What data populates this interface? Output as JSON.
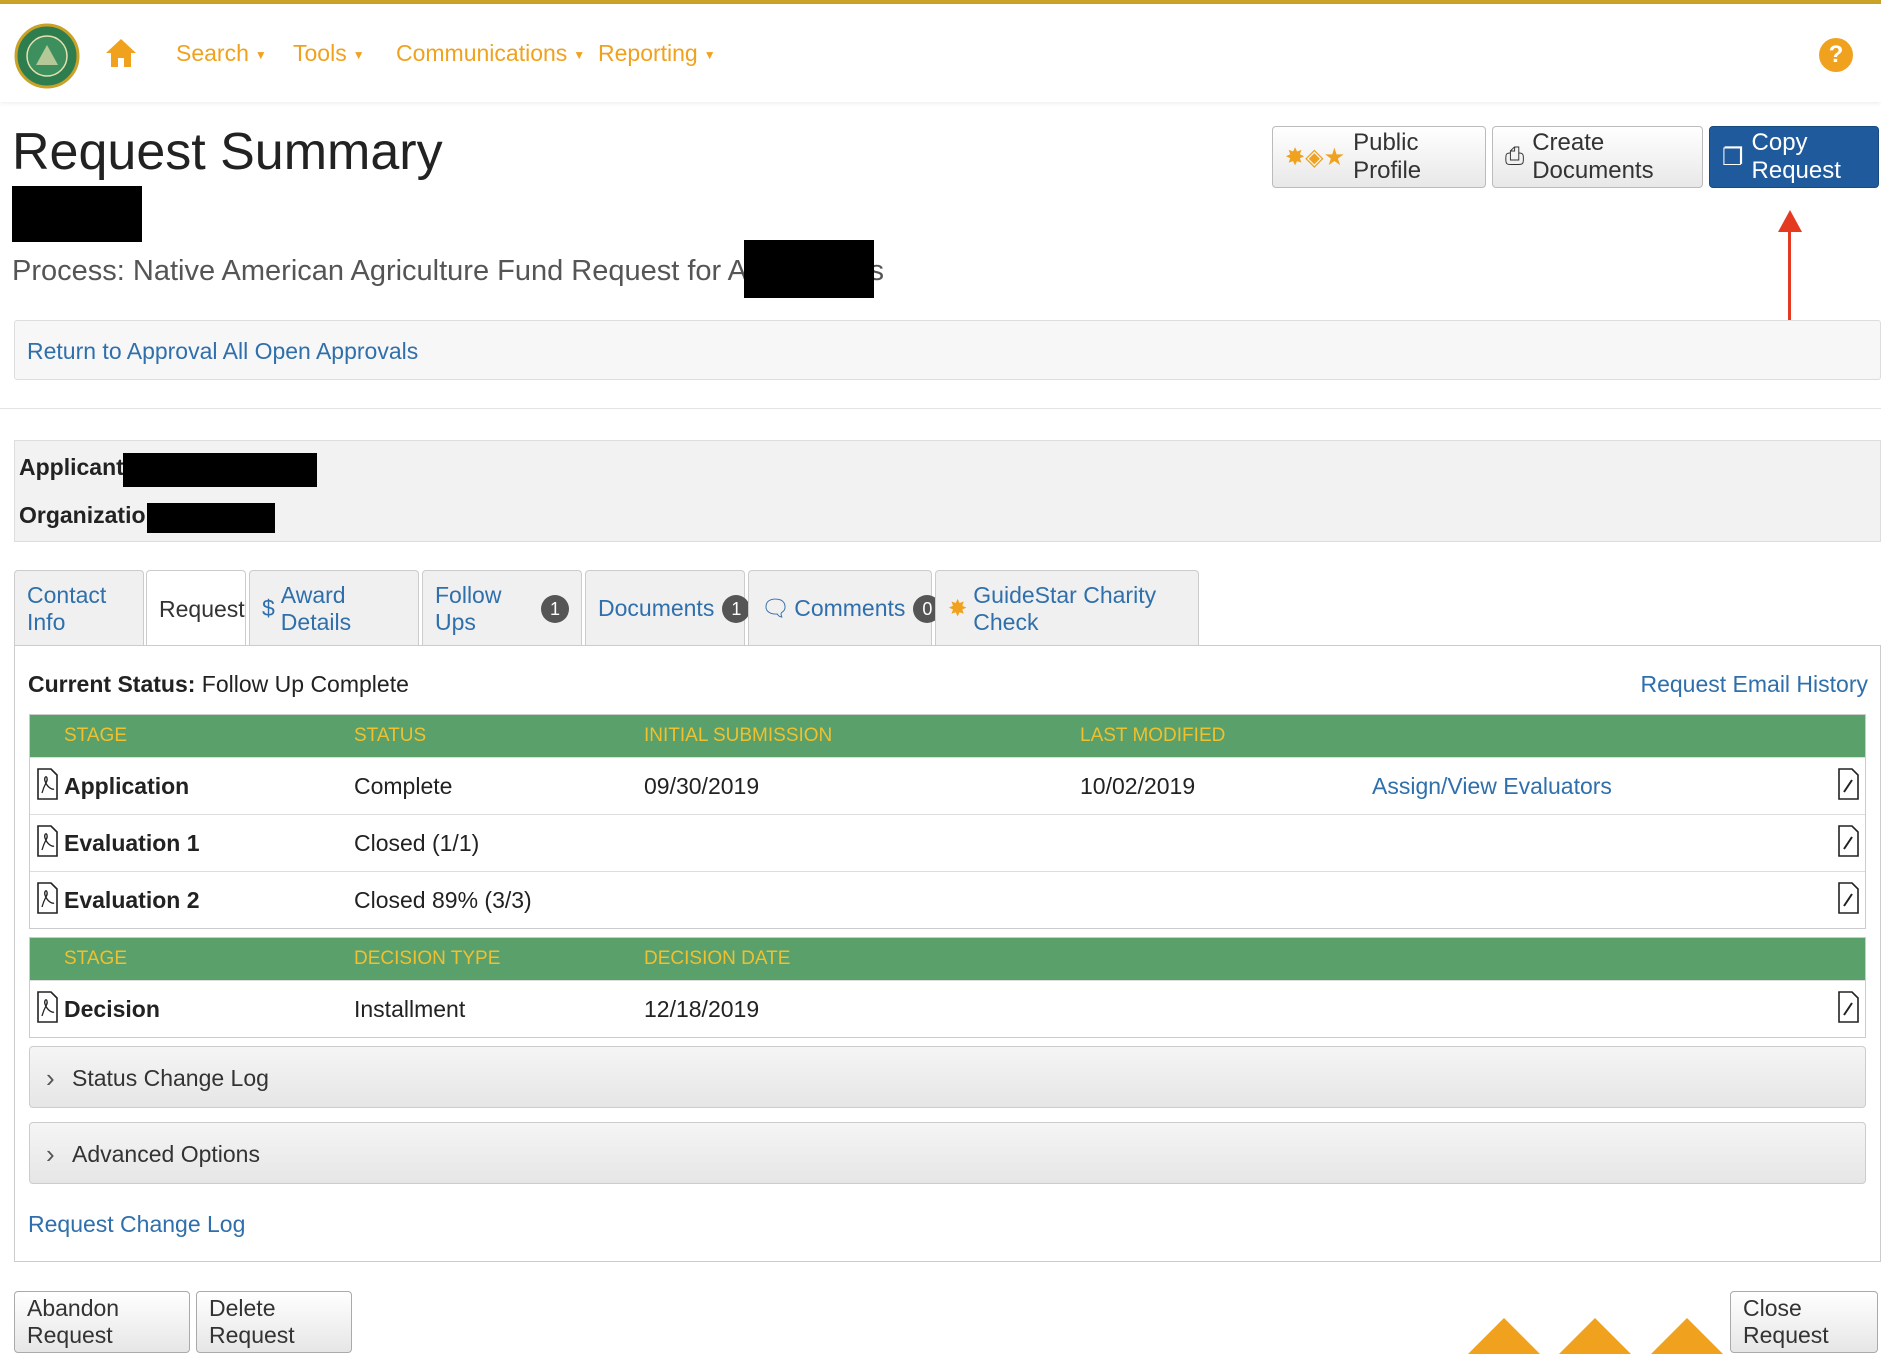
{
  "colors": {
    "accent": "#f0a21e",
    "primary_button": "#1e5a9c",
    "table_header": "#5aa06b",
    "link": "#2f6fab",
    "arrow": "#e53a22"
  },
  "nav": {
    "items": [
      "Search",
      "Tools",
      "Communications",
      "Reporting"
    ],
    "help_label": "?"
  },
  "header": {
    "title": "Request Summary",
    "process": "Process: Native American Agriculture Fund Request for Applications",
    "buttons": {
      "public_profile": "Public Profile",
      "create_documents": "Create Documents",
      "copy_request": "Copy Request"
    }
  },
  "return_link": "Return to Approval All Open Approvals",
  "applicant": {
    "applicant_label": "Applicant:",
    "organization_label": "Organization:"
  },
  "tabs": [
    {
      "label": "Contact Info",
      "icon": ""
    },
    {
      "label": "Request",
      "icon": ""
    },
    {
      "label": "Award Details",
      "icon": "$"
    },
    {
      "label": "Follow Ups",
      "badge": "1"
    },
    {
      "label": "Documents",
      "badge": "1"
    },
    {
      "label": "Comments",
      "badge": "0"
    },
    {
      "label": "GuideStar Charity Check"
    }
  ],
  "status": {
    "label": "Current Status:",
    "value": "Follow Up Complete",
    "email_history": "Request Email History"
  },
  "stages_table": {
    "headers": [
      "STAGE",
      "STATUS",
      "INITIAL SUBMISSION",
      "LAST MODIFIED"
    ],
    "rows": [
      {
        "stage": "Application",
        "status": "Complete",
        "initial": "09/30/2019",
        "modified": "10/02/2019",
        "action": "Assign/View Evaluators"
      },
      {
        "stage": "Evaluation 1",
        "status": "Closed (1/1)",
        "initial": "",
        "modified": "",
        "action": ""
      },
      {
        "stage": "Evaluation 2",
        "status": "Closed 89% (3/3)",
        "initial": "",
        "modified": "",
        "action": ""
      }
    ]
  },
  "decision_table": {
    "headers": [
      "STAGE",
      "DECISION TYPE",
      "DECISION DATE"
    ],
    "rows": [
      {
        "stage": "Decision",
        "type": "Installment",
        "date": "12/18/2019"
      }
    ]
  },
  "accordions": [
    "Status Change Log",
    "Advanced Options"
  ],
  "request_change_log": "Request Change Log",
  "footer": {
    "abandon": "Abandon Request",
    "delete": "Delete Request",
    "close": "Close Request"
  }
}
